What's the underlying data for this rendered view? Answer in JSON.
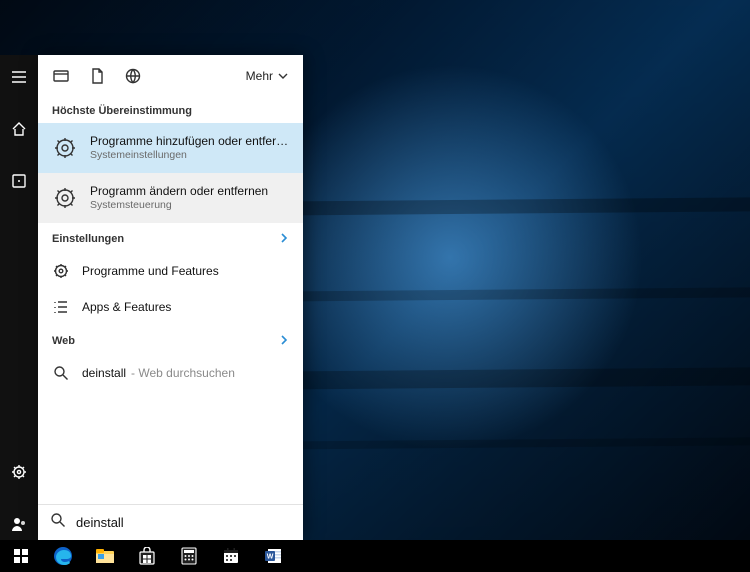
{
  "filters": {
    "more_label": "Mehr"
  },
  "sections": {
    "best_match": "Höchste Übereinstimmung",
    "settings": "Einstellungen",
    "web": "Web"
  },
  "results": {
    "r1": {
      "title": "Programme hinzufügen oder entfernen",
      "subtitle": "Systemeinstellungen"
    },
    "r2": {
      "title": "Programm ändern oder entfernen",
      "subtitle": "Systemsteuerung"
    },
    "r3": {
      "title": "Programme und Features"
    },
    "r4": {
      "title": "Apps & Features"
    },
    "web1": {
      "query": "deinstall",
      "hint": "- Web durchsuchen"
    }
  },
  "search": {
    "value": "deinstall"
  }
}
